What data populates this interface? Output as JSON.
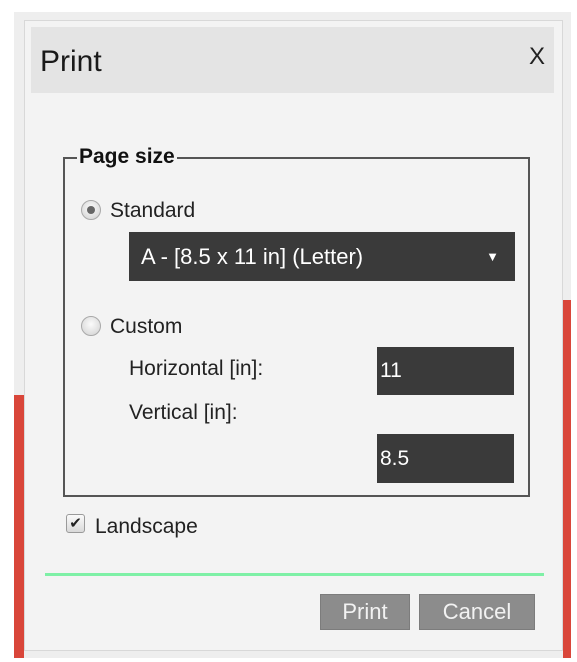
{
  "dialog": {
    "title": "Print",
    "close_label": "X"
  },
  "page_size": {
    "legend": "Page size",
    "standard": {
      "label": "Standard",
      "selected": true,
      "dropdown_value": "A - [8.5 x 11 in] (Letter)",
      "dropdown_arrow": "▼"
    },
    "custom": {
      "label": "Custom",
      "selected": false,
      "horizontal_label": "Horizontal [in]:",
      "horizontal_value": "11",
      "vertical_label": "Vertical [in]:",
      "vertical_value": "8.5"
    }
  },
  "landscape": {
    "label": "Landscape",
    "checked": true,
    "check_glyph": "✔"
  },
  "buttons": {
    "print_label": "Print",
    "cancel_label": "Cancel"
  },
  "colors": {
    "input_background": "#3a3a3a",
    "button_background": "#8c8c8c",
    "divider_green": "#7ef0a6",
    "accent_red": "#d9463a"
  }
}
